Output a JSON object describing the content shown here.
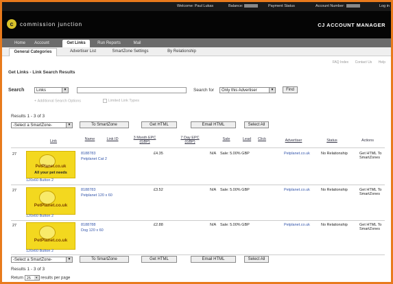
{
  "topbar": {
    "welcome": "Welcome: Paul Lukas",
    "balance_label": "Balance:",
    "payment_link": "Payment Status",
    "account_label": "Account Number:",
    "logout": "Log in"
  },
  "brand": {
    "logo_letter": "c",
    "name": "commission junction",
    "product": "CJ ACCOUNT MANAGER"
  },
  "nav": {
    "tabs": [
      "Home",
      "Account",
      "Get Links",
      "Run Reports",
      "Mail"
    ],
    "active": "Get Links"
  },
  "subnav": {
    "tabs": [
      "General Categories",
      "Advertiser List",
      "SmartZone Settings",
      "By Relationship"
    ],
    "active": "General Categories"
  },
  "utility_links": [
    "FAQ Index",
    "Contact Us",
    "Help"
  ],
  "page_title": "Get Links - Link Search Results",
  "search": {
    "label": "Search",
    "type_value": "Links",
    "query_value": "",
    "search_for_label": "Search for",
    "scope_value": "Only this Advertiser",
    "find_label": "Find",
    "additional_options": "Additional Search Options",
    "limited_links": "Limited Link Types"
  },
  "results_summary": "Results 1 - 3 of 3",
  "actions": {
    "smartzone_select": "-Select a SmartZone-",
    "to_smartzone": "To SmartZone",
    "get_html": "Get HTML",
    "email_html": "Email HTML",
    "select_all": "Select All"
  },
  "columns": {
    "link": "Link",
    "name": "Name",
    "link_id": "Link ID",
    "epc_3month": "3 Month EPC (GBP)",
    "epc_7day": "7 Day EPC (GBP)",
    "sale": "Sale",
    "lead": "Lead",
    "click": "Click",
    "advertiser": "Advertiser",
    "status": "Status",
    "actions": "Actions"
  },
  "rows": [
    {
      "num": "27",
      "banner_line1": "PetPlanet.co.uk",
      "banner_line2": "All your pet needs",
      "banner_size": "120x60 Button 2",
      "link_id": "8188783",
      "name": "Petplanet Cat 2",
      "epc_3month": "£4.35",
      "epc_7day": "N/A",
      "sale": "Sale: 5.00% GBP",
      "advertiser": "Petplanet.co.uk",
      "status": "No Relationship",
      "action": "Get HTML To SmartZones"
    },
    {
      "num": "27",
      "banner_line1": "PetPlanet.co.uk",
      "banner_line2": "",
      "banner_size": "120x60 Button 2",
      "link_id": "8188783",
      "name": "Petplanet 120 x 60",
      "epc_3month": "£3.52",
      "epc_7day": "N/A",
      "sale": "Sale: 5.00% GBP",
      "advertiser": "Petplanet.co.uk",
      "status": "No Relationship",
      "action": "Get HTML To SmartZones"
    },
    {
      "num": "27",
      "banner_line1": "PetPlanet.co.uk",
      "banner_line2": "",
      "banner_size": "120x60 Button 2",
      "link_id": "8188788",
      "name": "Dog 120 x 60",
      "epc_3month": "£2.88",
      "epc_7day": "N/A",
      "sale": "Sale: 5.00% GBP",
      "advertiser": "Petplanet.co.uk",
      "status": "No Relationship",
      "action": "Get HTML To SmartZones"
    }
  ],
  "pagination": {
    "return_label": "Return",
    "per_page_value": "25",
    "per_page_suffix": "results per page"
  },
  "colors": {
    "page_border": "#e87a1c",
    "header_bg": "#050505",
    "nav_bg": "#6b6b6b",
    "banner_yellow": "#f3d81f",
    "link_blue": "#3355aa"
  }
}
